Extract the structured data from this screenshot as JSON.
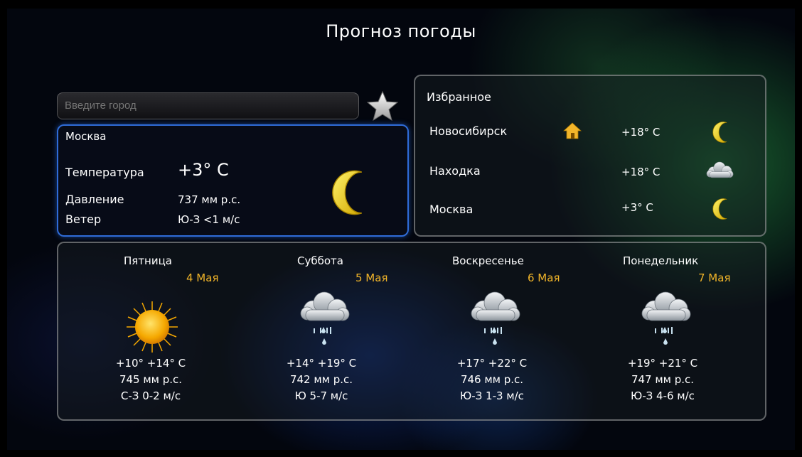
{
  "app": {
    "title": "Прогноз погоды"
  },
  "search": {
    "placeholder": "Введите город"
  },
  "current": {
    "city": "Москва",
    "temperature_label": "Температура",
    "temperature_value": "+3° C",
    "pressure_label": "Давление",
    "pressure_value": "737 мм р.с.",
    "wind_label": "Ветер",
    "wind_value": "Ю-З <1 м/с",
    "icon": "moon-icon"
  },
  "favorites": {
    "title": "Избранное",
    "items": [
      {
        "city": "Новосибирск",
        "temp": "+18° C",
        "icon": "moon-icon",
        "home": true
      },
      {
        "city": "Находка",
        "temp": "+18° C",
        "icon": "cloud-icon",
        "home": false
      },
      {
        "city": "Москва",
        "temp": "+3° C",
        "icon": "moon-icon",
        "home": false
      }
    ]
  },
  "forecast": [
    {
      "day": "Пятница",
      "date": "4 Мая",
      "icon": "sun-icon",
      "temp": "+10° +14° C",
      "pressure": "745 мм р.с.",
      "wind": "С-З  0-2 м/с"
    },
    {
      "day": "Суббота",
      "date": "5 Мая",
      "icon": "rain-cloud-icon",
      "temp": "+14° +19° C",
      "pressure": "742 мм р.с.",
      "wind": "Ю  5-7 м/с"
    },
    {
      "day": "Воскресенье",
      "date": "6 Мая",
      "icon": "rain-cloud-icon",
      "temp": "+17° +22° C",
      "pressure": "746 мм р.с.",
      "wind": "Ю-З  1-3 м/с"
    },
    {
      "day": "Понедельник",
      "date": "7 Мая",
      "icon": "rain-cloud-icon",
      "temp": "+19° +21° C",
      "pressure": "747 мм р.с.",
      "wind": "Ю-З  4-6 м/с"
    }
  ],
  "colors": {
    "accent": "#2f6cd8",
    "date": "#f0b429",
    "moon": "#f2d21a",
    "sun": "#f5a800"
  }
}
